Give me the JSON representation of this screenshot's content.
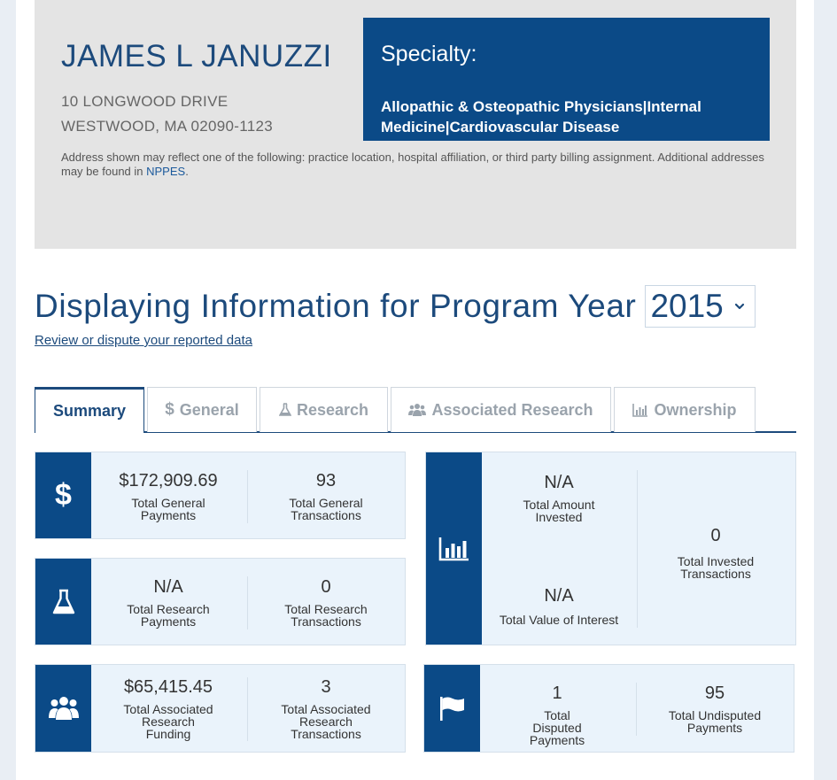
{
  "physician": {
    "name": "JAMES L JANUZZI",
    "address_line1": "10 LONGWOOD DRIVE",
    "address_line2": "WESTWOOD, MA 02090-1123",
    "address_note": "Address shown may reflect one of the following: practice location, hospital affiliation, or third party billing assignment. Additional addresses may be found in ",
    "address_note_link": "NPPES",
    "address_note_end": "."
  },
  "specialty": {
    "title": "Specialty:",
    "text": "Allopathic & Osteopathic Physicians|Internal Medicine|Cardiovascular Disease"
  },
  "program_year": {
    "heading": "Displaying Information for Program Year",
    "selected": "2015",
    "review_link": "Review or dispute your reported data"
  },
  "tabs": [
    {
      "label": "Summary",
      "icon": "none",
      "active": true
    },
    {
      "label": "General",
      "icon": "dollar-icon",
      "active": false
    },
    {
      "label": "Research",
      "icon": "flask-icon",
      "active": false
    },
    {
      "label": "Associated Research",
      "icon": "users-icon",
      "active": false
    },
    {
      "label": "Ownership",
      "icon": "bar-chart-icon",
      "active": false
    }
  ],
  "cards": {
    "general": {
      "icon": "dollar-icon",
      "payments_value": "$172,909.69",
      "payments_label": "Total General Payments",
      "transactions_value": "93",
      "transactions_label": "Total General Transactions"
    },
    "research": {
      "icon": "flask-icon",
      "payments_value": "N/A",
      "payments_label": "Total Research Payments",
      "transactions_value": "0",
      "transactions_label": "Total Research Transactions"
    },
    "associated": {
      "icon": "users-icon",
      "funding_value": "$65,415.45",
      "funding_label": "Total Associated Research Funding",
      "transactions_value": "3",
      "transactions_label": "Total Associated Research Transactions"
    },
    "ownership": {
      "icon": "bar-chart-icon",
      "invested_value": "N/A",
      "invested_label": "Total Amount Invested",
      "interest_value": "N/A",
      "interest_label": "Total Value of Interest",
      "transactions_value": "0",
      "transactions_label": "Total Invested Transactions"
    },
    "disputes": {
      "icon": "flag-icon",
      "disputed_value": "1",
      "disputed_label": "Total Disputed Payments",
      "undisputed_value": "95",
      "undisputed_label": "Total Undisputed Payments"
    }
  },
  "colors": {
    "brand_blue": "#0b4a87",
    "heading_blue": "#1c4a7c",
    "card_bg": "#eaf3fb",
    "header_bg": "#e4e4e4"
  }
}
